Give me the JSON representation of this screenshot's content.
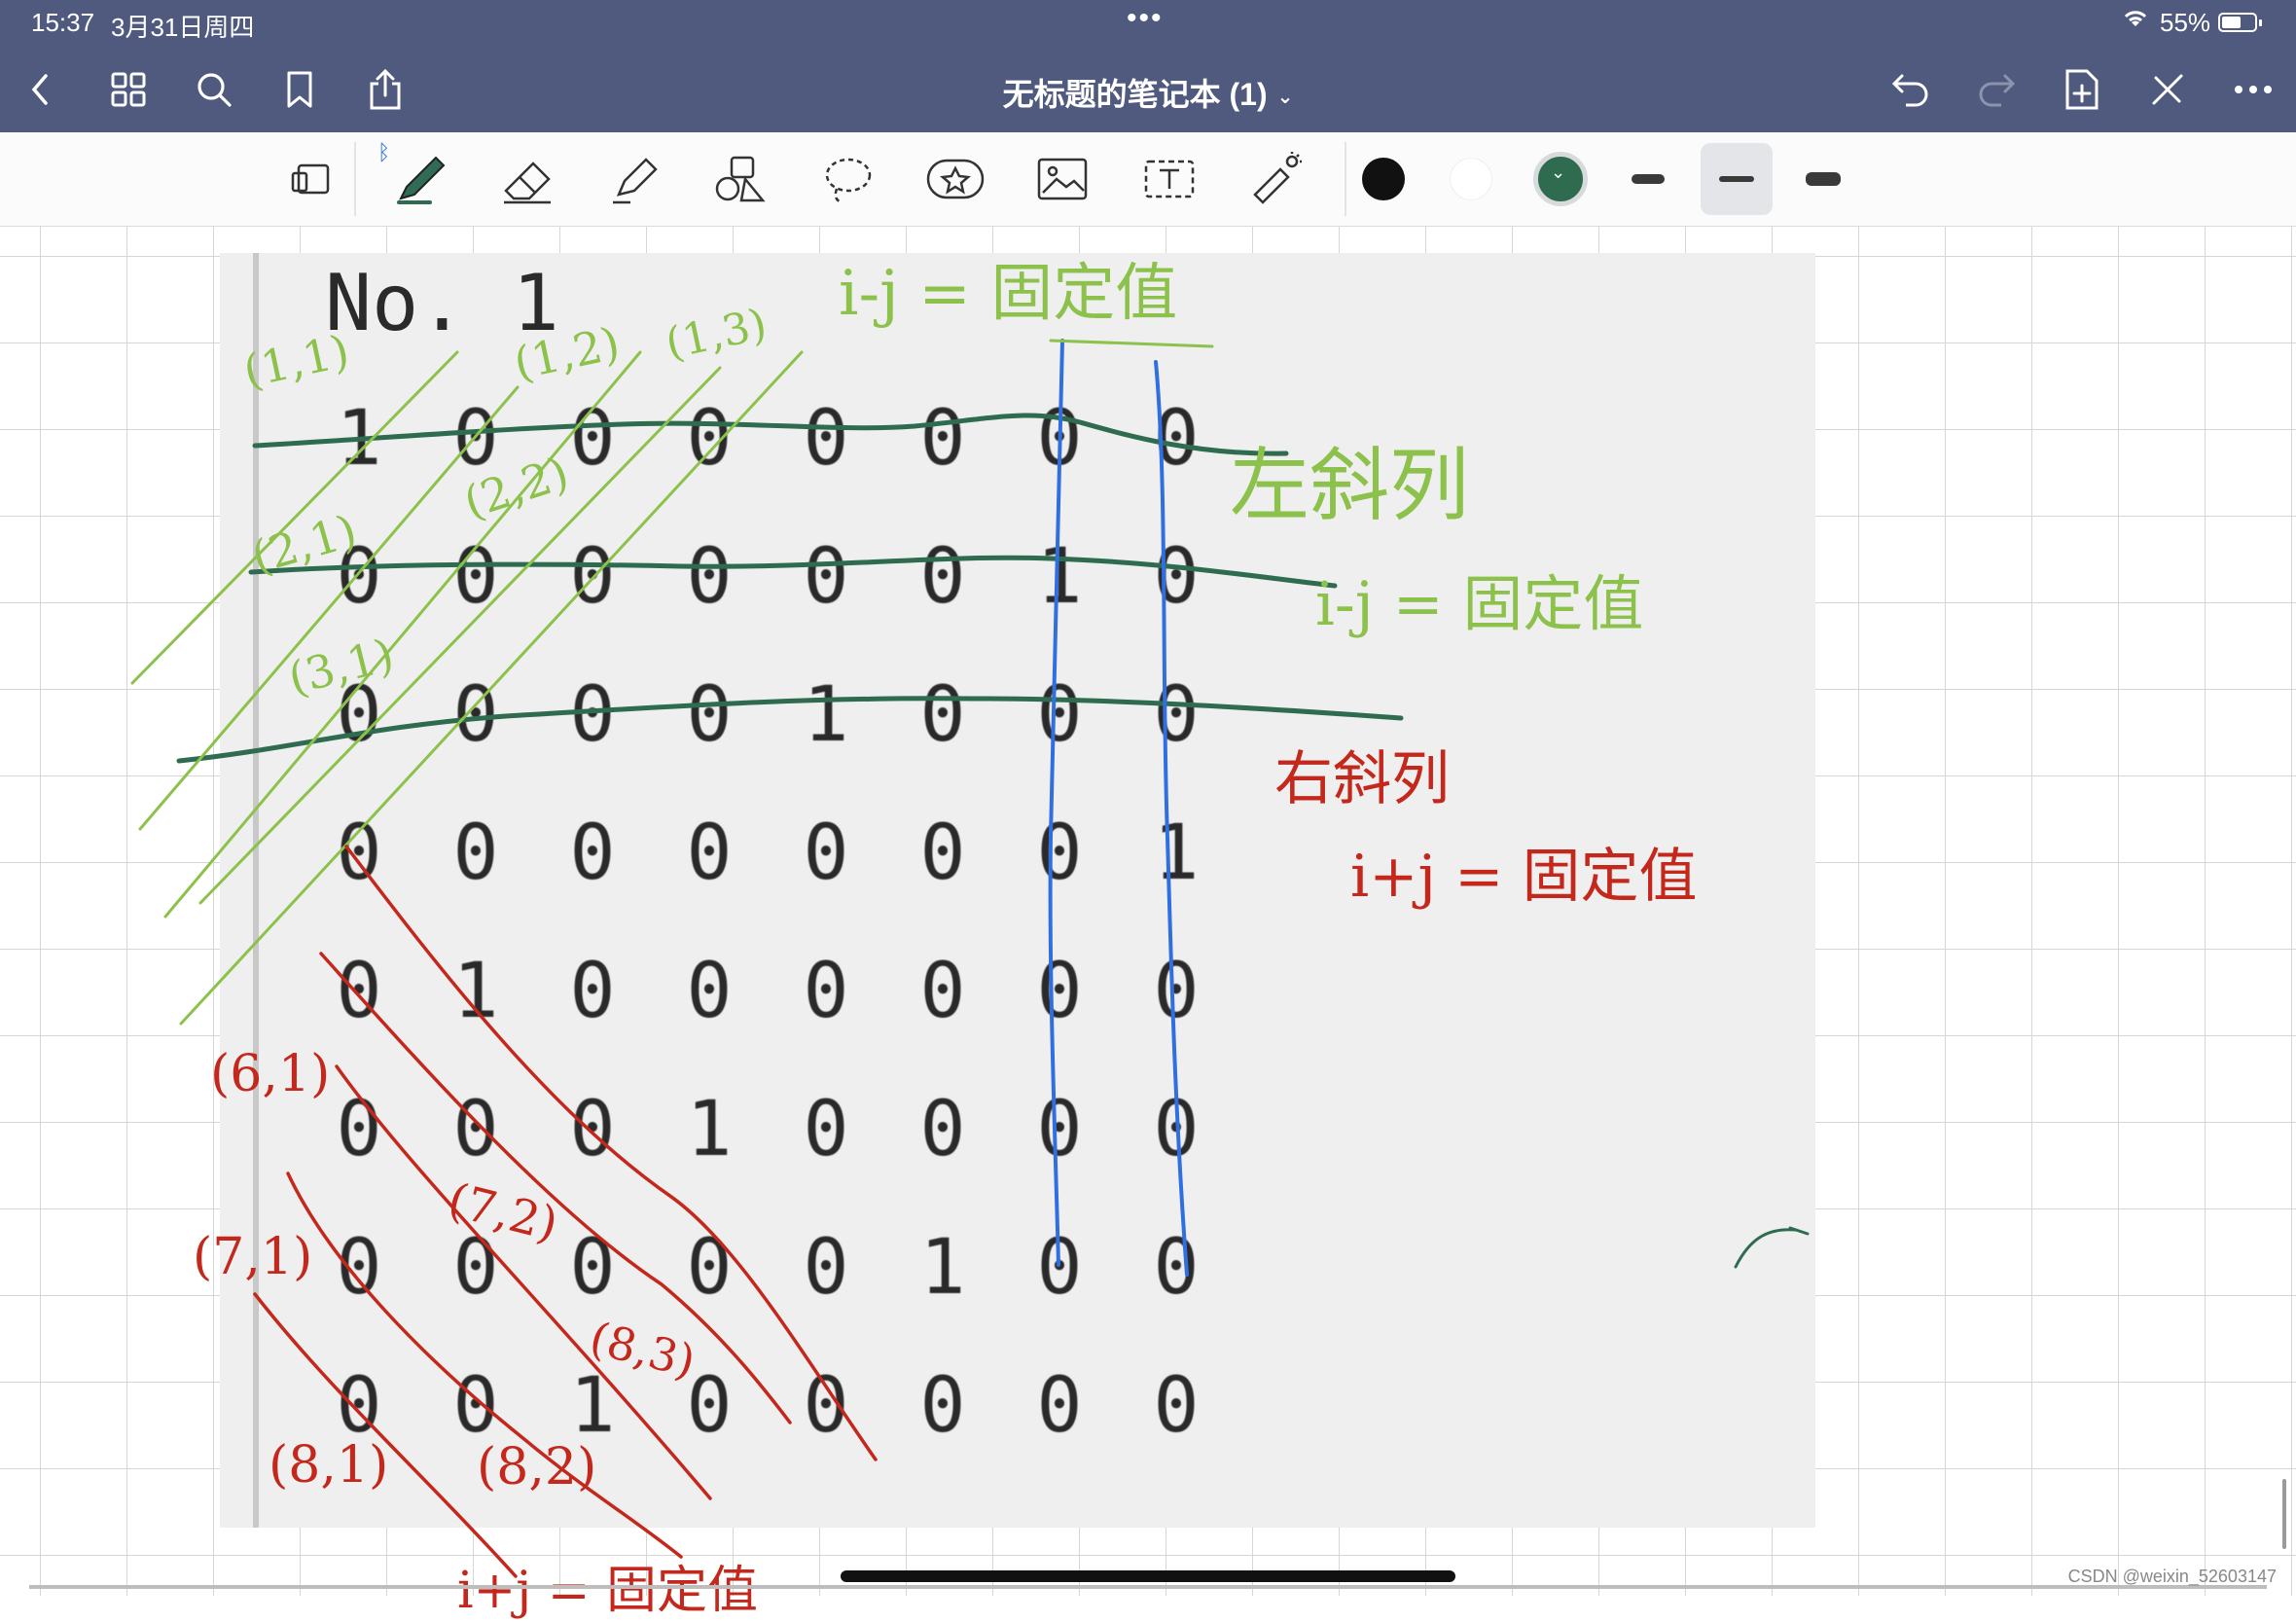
{
  "status_bar": {
    "time": "15:37",
    "date": "3月31日周四",
    "center_dots": "•••",
    "battery": "55%"
  },
  "nav": {
    "title": "无标题的笔记本 (1)",
    "left_icons": [
      "back-chevron-icon",
      "grid-icon",
      "search-icon",
      "bookmark-icon",
      "share-icon"
    ],
    "right_icons": [
      "undo-icon",
      "redo-icon",
      "add-page-icon",
      "close-x-icon",
      "more-icon"
    ]
  },
  "toolbar": {
    "tools": [
      "page-layout-icon",
      "pen-icon",
      "eraser-icon",
      "highlighter-icon",
      "shapes-icon",
      "lasso-icon",
      "sticker-icon",
      "image-icon",
      "text-icon",
      "laser-pointer-icon"
    ],
    "colors": {
      "black": "#111111",
      "white": "#ffffff",
      "green": "#2e6b4f"
    },
    "bluetooth_indicator": "bluetooth-icon"
  },
  "document": {
    "heading": "No. 1",
    "matrix": [
      [
        "1",
        "0",
        "0",
        "0",
        "0",
        "0",
        "0",
        "0"
      ],
      [
        "0",
        "0",
        "0",
        "0",
        "0",
        "0",
        "1",
        "0"
      ],
      [
        "0",
        "0",
        "0",
        "0",
        "1",
        "0",
        "0",
        "0"
      ],
      [
        "0",
        "0",
        "0",
        "0",
        "0",
        "0",
        "0",
        "1"
      ],
      [
        "0",
        "1",
        "0",
        "0",
        "0",
        "0",
        "0",
        "0"
      ],
      [
        "0",
        "0",
        "0",
        "1",
        "0",
        "0",
        "0",
        "0"
      ],
      [
        "0",
        "0",
        "0",
        "0",
        "0",
        "1",
        "0",
        "0"
      ],
      [
        "0",
        "0",
        "1",
        "0",
        "0",
        "0",
        "0",
        "0"
      ]
    ]
  },
  "annotations": {
    "green": {
      "top_title": "i-j = 固定值",
      "left_diag": "左斜列",
      "left_diag_rule": "i-j = 固定值",
      "coord_11": "(1,1)",
      "coord_12": "(1,2)",
      "coord_13": "(1,3)",
      "coord_21": "(2,1)",
      "coord_22": "(2,2)",
      "coord_31": "(3,1)"
    },
    "red": {
      "right_diag": "右斜列",
      "right_diag_rule": "i+j = 固定值",
      "coord_61": "(6,1)",
      "coord_72": "(7,2)",
      "coord_71": "(7,1)",
      "coord_82": "(8,2)",
      "coord_81": "(8,1)",
      "coord_83": "(8,3)",
      "bottom_cut": "i+j = 固定值"
    },
    "colors": {
      "green": "#8cc24b",
      "dark_green": "#2e6b4f",
      "red": "#c4281c",
      "blue": "#2f6fe0"
    }
  },
  "watermark": "CSDN @weixin_52603147"
}
